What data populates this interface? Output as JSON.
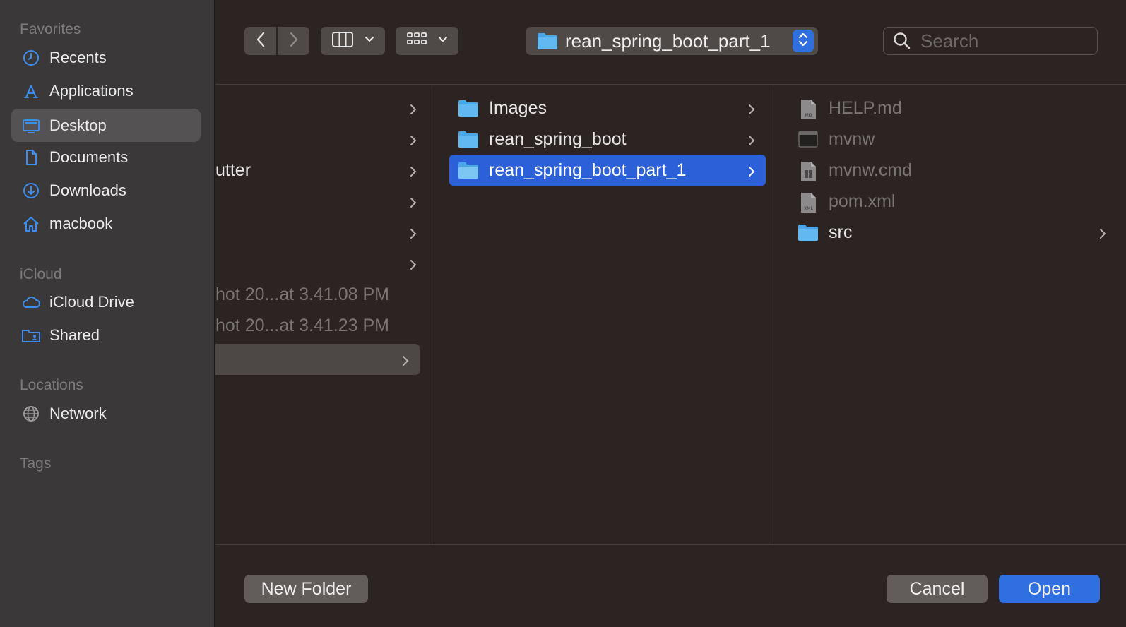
{
  "sidebar": {
    "favorites_header": "Favorites",
    "favorites": [
      {
        "label": "Recents",
        "icon": "clock-icon"
      },
      {
        "label": "Applications",
        "icon": "applications-icon"
      },
      {
        "label": "Desktop",
        "icon": "desktop-icon",
        "active": true
      },
      {
        "label": "Documents",
        "icon": "document-icon"
      },
      {
        "label": "Downloads",
        "icon": "download-icon"
      },
      {
        "label": "macbook",
        "icon": "home-icon"
      }
    ],
    "icloud_header": "iCloud",
    "icloud": [
      {
        "label": "iCloud Drive",
        "icon": "cloud-icon"
      },
      {
        "label": "Shared",
        "icon": "shared-folder-icon"
      }
    ],
    "locations_header": "Locations",
    "locations": [
      {
        "label": "Network",
        "icon": "globe-icon"
      }
    ],
    "tags_header": "Tags"
  },
  "toolbar": {
    "path_label": "rean_spring_boot_part_1",
    "search_placeholder": "Search"
  },
  "columns": {
    "col1": [
      {
        "label": "",
        "chevron": true
      },
      {
        "label": "",
        "chevron": true
      },
      {
        "label": "utter",
        "chevron": true
      },
      {
        "label": "",
        "chevron": true
      },
      {
        "label": "",
        "chevron": true
      },
      {
        "label": "",
        "chevron": true
      },
      {
        "label": "hot 20...at 3.41.08 PM",
        "chevron": false,
        "dim": true
      },
      {
        "label": "hot 20...at 3.41.23 PM",
        "chevron": false,
        "dim": true
      },
      {
        "label": "",
        "chevron": true,
        "selected_inactive": true
      }
    ],
    "col2": [
      {
        "label": "Images"
      },
      {
        "label": "rean_spring_boot"
      },
      {
        "label": "rean_spring_boot_part_1",
        "selected": true
      }
    ],
    "col3": [
      {
        "label": "HELP.md",
        "icon": "md-file-icon",
        "badge": "MD"
      },
      {
        "label": "mvnw",
        "icon": "terminal-file-icon"
      },
      {
        "label": "mvnw.cmd",
        "icon": "windows-file-icon"
      },
      {
        "label": "pom.xml",
        "icon": "xml-file-icon",
        "badge": "XML"
      },
      {
        "label": "src",
        "icon": "folder-icon",
        "folder": true
      }
    ]
  },
  "bottom": {
    "new_folder_label": "New Folder",
    "cancel_label": "Cancel",
    "open_label": "Open"
  },
  "colors": {
    "accent": "#2f6fe0",
    "selection": "#2b60d8",
    "folder": "#5bb4ea"
  }
}
